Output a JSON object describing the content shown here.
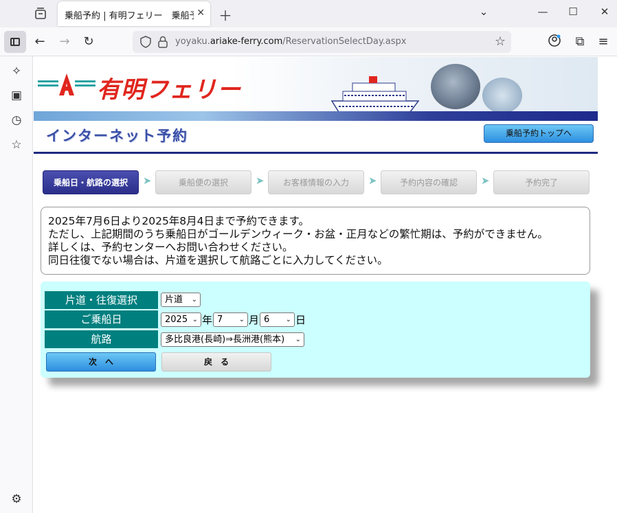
{
  "browser": {
    "tab_title": "乗船予約 | 有明フェリー　乗船予約",
    "url_prefix": "yoyaku.",
    "url_host": "ariake-ferry.com",
    "url_path": "/ReservationSelectDay.aspx"
  },
  "header": {
    "logo_text": "有明フェリー",
    "section_title": "インターネット予約",
    "top_button": "乗船予約トップへ"
  },
  "steps": [
    {
      "label": "乗船日・航路の選択",
      "state": "active"
    },
    {
      "label": "乗船便の選択",
      "state": "inactive"
    },
    {
      "label": "お客様情報の入力",
      "state": "inactive"
    },
    {
      "label": "予約内容の確認",
      "state": "inactive"
    },
    {
      "label": "予約完了",
      "state": "inactive"
    }
  ],
  "step_arrow": "➤",
  "notice": {
    "lines": [
      "2025年7月6日より2025年8月4日まで予約できます。",
      "ただし、上記期間のうち乗船日がゴールデンウィーク・お盆・正月などの繁忙期は、予約ができません。",
      "詳しくは、予約センターへお問い合わせください。",
      "同日往復でない場合は、片道を選択して航路ごとに入力してください。"
    ]
  },
  "form": {
    "trip_type_label": "片道・往復選択",
    "trip_type_value": "片道",
    "date_label": "ご乗船日",
    "year_value": "2025",
    "year_unit": "年",
    "month_value": "7",
    "month_unit": "月",
    "day_value": "6",
    "day_unit": "日",
    "route_label": "航路",
    "route_value": "多比良港(長崎)⇒長洲港(熊本)",
    "next_button": "次　へ",
    "back_button": "戻　る"
  },
  "colors": {
    "form_bg": "#ccffff",
    "label_bg": "#007f7f",
    "active_step": "#2b2f8a",
    "brand_red": "#e0261e",
    "nav_blue": "#1f2a80"
  }
}
